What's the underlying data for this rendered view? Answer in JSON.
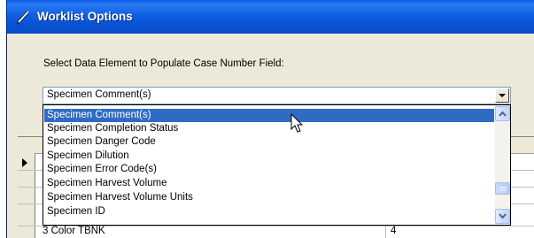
{
  "window": {
    "title": "Worklist Options"
  },
  "prompt_label": "Select Data Element to Populate Case Number Field:",
  "case_number_combo": {
    "selected_value": "Specimen Comment(s)"
  },
  "dropdown": {
    "options": [
      {
        "label": "Specimen Comment(s)",
        "selected": true
      },
      {
        "label": "Specimen Completion Status",
        "selected": false
      },
      {
        "label": "Specimen Danger Code",
        "selected": false
      },
      {
        "label": "Specimen Dilution",
        "selected": false
      },
      {
        "label": "Specimen Error Code(s)",
        "selected": false
      },
      {
        "label": "Specimen Harvest Volume",
        "selected": false
      },
      {
        "label": "Specimen Harvest Volume Units",
        "selected": false
      },
      {
        "label": "Specimen ID",
        "selected": false
      }
    ]
  },
  "grid": {
    "partial_row_name": "3 Color TBNK",
    "partial_row_value": "4"
  },
  "colors": {
    "title_bar": "#0a5ce8",
    "selection": "#316ac5",
    "dialog_face": "#ece9d8"
  },
  "icons": {
    "title": "pen-icon",
    "cursor": "mouse-pointer-icon"
  }
}
